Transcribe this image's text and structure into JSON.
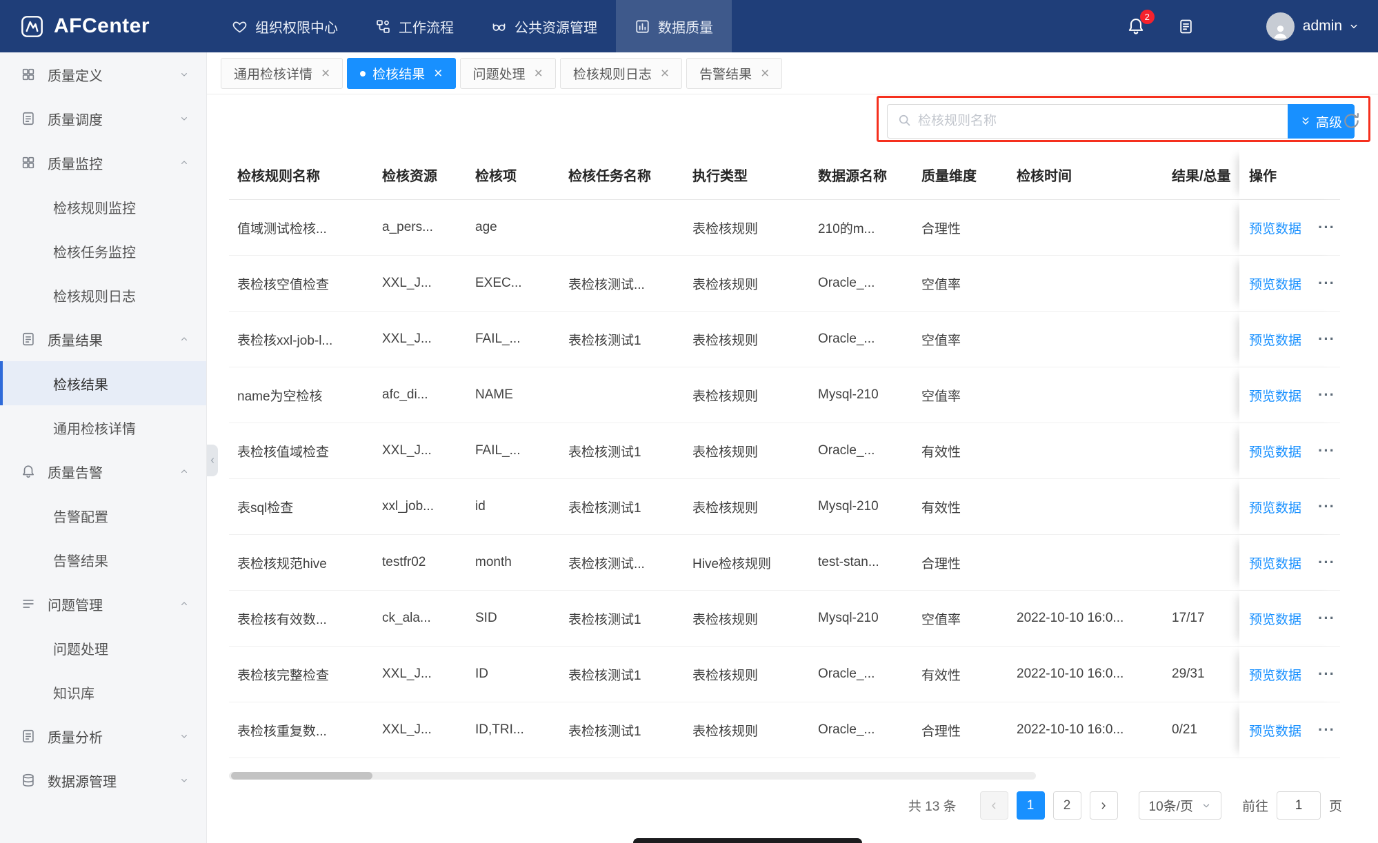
{
  "colors": {
    "accent": "#1890ff",
    "header_bg": "#1f3e79",
    "annotation_red": "#f5301e",
    "link": "#1890ff"
  },
  "header": {
    "logo_text": "AFCenter",
    "nav_items": [
      {
        "label": "组织权限中心",
        "icon": "heart-icon",
        "active": false
      },
      {
        "label": "工作流程",
        "icon": "workflow-icon",
        "active": false
      },
      {
        "label": "公共资源管理",
        "icon": "resource-icon",
        "active": false
      },
      {
        "label": "数据质量",
        "icon": "data-quality-icon",
        "active": true
      }
    ],
    "notification_badge": "2",
    "username": "admin"
  },
  "sidebar": {
    "items": [
      {
        "label": "质量定义",
        "icon": "grid-icon",
        "state": "collapsed",
        "children": []
      },
      {
        "label": "质量调度",
        "icon": "document-icon",
        "state": "collapsed",
        "children": []
      },
      {
        "label": "质量监控",
        "icon": "grid-icon",
        "state": "expanded",
        "children": [
          {
            "label": "检核规则监控"
          },
          {
            "label": "检核任务监控"
          },
          {
            "label": "检核规则日志"
          }
        ]
      },
      {
        "label": "质量结果",
        "icon": "document-icon",
        "state": "expanded",
        "children": [
          {
            "label": "检核结果",
            "active": true
          },
          {
            "label": "通用检核详情"
          }
        ]
      },
      {
        "label": "质量告警",
        "icon": "bell-icon",
        "state": "expanded",
        "children": [
          {
            "label": "告警配置"
          },
          {
            "label": "告警结果"
          }
        ]
      },
      {
        "label": "问题管理",
        "icon": "list-icon",
        "state": "expanded",
        "children": [
          {
            "label": "问题处理"
          },
          {
            "label": "知识库"
          }
        ]
      },
      {
        "label": "质量分析",
        "icon": "document-icon",
        "state": "collapsed",
        "children": []
      },
      {
        "label": "数据源管理",
        "icon": "database-icon",
        "state": "collapsed",
        "children": []
      }
    ]
  },
  "tabs": {
    "items": [
      {
        "label": "通用检核详情",
        "active": false
      },
      {
        "label": "检核结果",
        "active": true
      },
      {
        "label": "问题处理",
        "active": false
      },
      {
        "label": "检核规则日志",
        "active": false
      },
      {
        "label": "告警结果",
        "active": false
      }
    ]
  },
  "toolbar": {
    "search_placeholder": "检核规则名称",
    "advanced_label": "高级"
  },
  "table": {
    "columns": [
      "检核规则名称",
      "检核资源",
      "检核项",
      "检核任务名称",
      "执行类型",
      "数据源名称",
      "质量维度",
      "检核时间",
      "结果/总量",
      "操作"
    ],
    "action_link": "预览数据",
    "more_icon": "···",
    "rows": [
      [
        "值域测试检核...",
        "a_pers...",
        "age",
        "",
        "表检核规则",
        "210的m...",
        "合理性",
        "",
        ""
      ],
      [
        "表检核空值检查",
        "XXL_J...",
        "EXEC...",
        "表检核测试...",
        "表检核规则",
        "Oracle_...",
        "空值率",
        "",
        ""
      ],
      [
        "表检核xxl-job-l...",
        "XXL_J...",
        "FAIL_...",
        "表检核测试1",
        "表检核规则",
        "Oracle_...",
        "空值率",
        "",
        ""
      ],
      [
        "name为空检核",
        "afc_di...",
        "NAME",
        "",
        "表检核规则",
        "Mysql-210",
        "空值率",
        "",
        ""
      ],
      [
        "表检核值域检查",
        "XXL_J...",
        "FAIL_...",
        "表检核测试1",
        "表检核规则",
        "Oracle_...",
        "有效性",
        "",
        ""
      ],
      [
        "表sql检查",
        "xxl_job...",
        "id",
        "表检核测试1",
        "表检核规则",
        "Mysql-210",
        "有效性",
        "",
        ""
      ],
      [
        "表检核规范hive",
        "testfr02",
        "month",
        "表检核测试...",
        "Hive检核规则",
        "test-stan...",
        "合理性",
        "",
        ""
      ],
      [
        "表检核有效数...",
        "ck_ala...",
        "SID",
        "表检核测试1",
        "表检核规则",
        "Mysql-210",
        "空值率",
        "2022-10-10 16:0...",
        "17/17"
      ],
      [
        "表检核完整检查",
        "XXL_J...",
        "ID",
        "表检核测试1",
        "表检核规则",
        "Oracle_...",
        "有效性",
        "2022-10-10 16:0...",
        "29/31"
      ],
      [
        "表检核重复数...",
        "XXL_J...",
        "ID,TRI...",
        "表检核测试1",
        "表检核规则",
        "Oracle_...",
        "合理性",
        "2022-10-10 16:0...",
        "0/21"
      ]
    ]
  },
  "pagination": {
    "total_text": "共 13 条",
    "page_numbers": [
      "1",
      "2"
    ],
    "active_page": "1",
    "page_size_label": "10条/页",
    "goto_label": "前往",
    "goto_value": "1",
    "goto_unit": "页"
  }
}
